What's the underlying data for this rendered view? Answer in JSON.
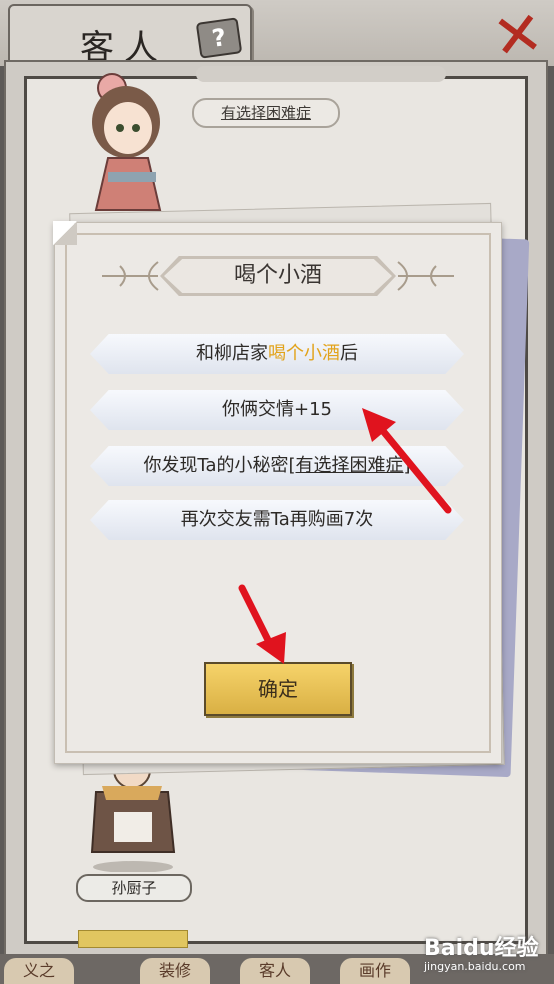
{
  "header": {
    "title": "客人",
    "help_icon": "?",
    "close_icon": "✕"
  },
  "background": {
    "top_tag": "有选择困难症",
    "bottom_name": "孙厨子",
    "nav": [
      "义之",
      "装修",
      "客人",
      "画作"
    ]
  },
  "dialog": {
    "title": "喝个小酒",
    "lines": [
      {
        "prefix": "和柳店家",
        "highlight": "喝个小酒",
        "suffix": "后"
      },
      {
        "text": "你俩交情+15"
      },
      {
        "prefix": "你发现Ta的小秘密[",
        "underlined": "有选择困难症",
        "suffix": "]"
      },
      {
        "text": "再次交友需Ta再购画7次"
      }
    ],
    "ok_label": "确定"
  },
  "watermark": {
    "brand": "Baidu经验",
    "url": "jingyan.baidu.com"
  },
  "colors": {
    "highlight": "#e2a31b",
    "button": "#f0c95c",
    "arrow": "#e0131e"
  }
}
